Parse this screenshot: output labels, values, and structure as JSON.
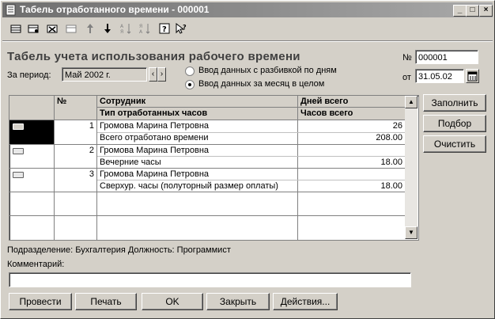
{
  "window": {
    "title": "Табель отработанного времени - 000001"
  },
  "toolbar": {
    "tools": [
      "new-row-icon",
      "copy-row-icon",
      "delete-row-icon",
      "edit-row-icon",
      "move-up-icon",
      "move-down-icon",
      "sort-asc-icon",
      "sort-desc-icon",
      "help-icon",
      "context-help-icon"
    ]
  },
  "form": {
    "heading": "Табель учета использования рабочего времени",
    "period_label": "За период:",
    "period_value": "Май 2002 г.",
    "radio_by_days": "Ввод данных с разбивкой по дням",
    "radio_whole_month": "Ввод данных за месяц в целом",
    "number_label": "№",
    "number_value": "000001",
    "date_label": "от",
    "date_value": "31.05.02"
  },
  "table": {
    "headers": {
      "num": "№",
      "employee": "Сотрудник",
      "hours_type": "Тип отработанных часов",
      "days_total": "Дней всего",
      "hours_total": "Часов всего"
    },
    "rows": [
      {
        "num": "1",
        "employee": "Громова Марина Петровна",
        "hours_type": "Всего отработано времени",
        "days": "26",
        "hours": "208.00"
      },
      {
        "num": "2",
        "employee": "Громова Марина Петровна",
        "hours_type": "Вечерние часы",
        "days": "",
        "hours": "18.00"
      },
      {
        "num": "3",
        "employee": "Громова Марина Петровна",
        "hours_type": "Сверхур. часы (полуторный размер оплаты)",
        "days": "",
        "hours": "18.00"
      }
    ]
  },
  "side_buttons": {
    "fill": "Заполнить",
    "select": "Подбор",
    "clear": "Очистить"
  },
  "info": {
    "department_line": "Подразделение: Бухгалтерия Должность: Программист",
    "comment_label": "Комментарий:",
    "comment_value": ""
  },
  "bottom_buttons": {
    "post": "Провести",
    "print": "Печать",
    "ok": "OK",
    "close": "Закрыть",
    "actions": "Действия..."
  }
}
